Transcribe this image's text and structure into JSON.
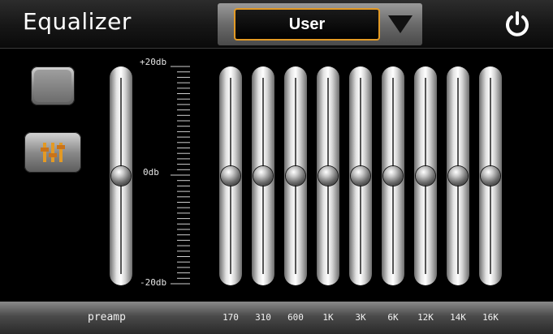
{
  "header": {
    "title": "Equalizer",
    "preset": "User"
  },
  "scale": {
    "top": "+20db",
    "mid": "0db",
    "bottom": "-20db",
    "min_db": -20,
    "max_db": 20
  },
  "preamp": {
    "label": "preamp",
    "value_db": 0
  },
  "bands": [
    {
      "label": "170",
      "value_db": 0
    },
    {
      "label": "310",
      "value_db": 0
    },
    {
      "label": "600",
      "value_db": 0
    },
    {
      "label": "1K",
      "value_db": 0
    },
    {
      "label": "3K",
      "value_db": 0
    },
    {
      "label": "6K",
      "value_db": 0
    },
    {
      "label": "12K",
      "value_db": 0
    },
    {
      "label": "14K",
      "value_db": 0
    },
    {
      "label": "16K",
      "value_db": 0
    }
  ],
  "icons": {
    "preset_dropdown": "chevron-down-icon",
    "power": "power-icon",
    "equalizer": "sliders-icon"
  },
  "colors": {
    "accent": "#e39a25",
    "background": "#000000"
  }
}
